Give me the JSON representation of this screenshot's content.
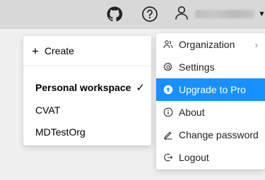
{
  "header": {
    "github_icon": "github-icon",
    "help_icon": "question-circle-icon",
    "user_icon": "user-icon",
    "user_name_redacted": true,
    "caret_icon": "caret-down-icon"
  },
  "workspace_menu": {
    "create_label": "Create",
    "items": [
      {
        "label": "Personal workspace",
        "selected": true
      },
      {
        "label": "CVAT",
        "selected": false
      },
      {
        "label": "MDTestOrg",
        "selected": false
      }
    ],
    "check_glyph": "✓"
  },
  "user_menu": {
    "items": [
      {
        "label": "Organization",
        "icon": "organization-icon",
        "submenu": true
      },
      {
        "label": "Settings",
        "icon": "gear-icon"
      },
      {
        "label": "Upgrade to Pro",
        "icon": "upgrade-icon",
        "active": true
      },
      {
        "label": "About",
        "icon": "info-icon"
      },
      {
        "label": "Change password",
        "icon": "edit-icon"
      },
      {
        "label": "Logout",
        "icon": "logout-icon"
      }
    ]
  },
  "colors": {
    "accent": "#1890ff",
    "topbar": "#d8d8d8",
    "page_bg": "#f0f0f0"
  }
}
